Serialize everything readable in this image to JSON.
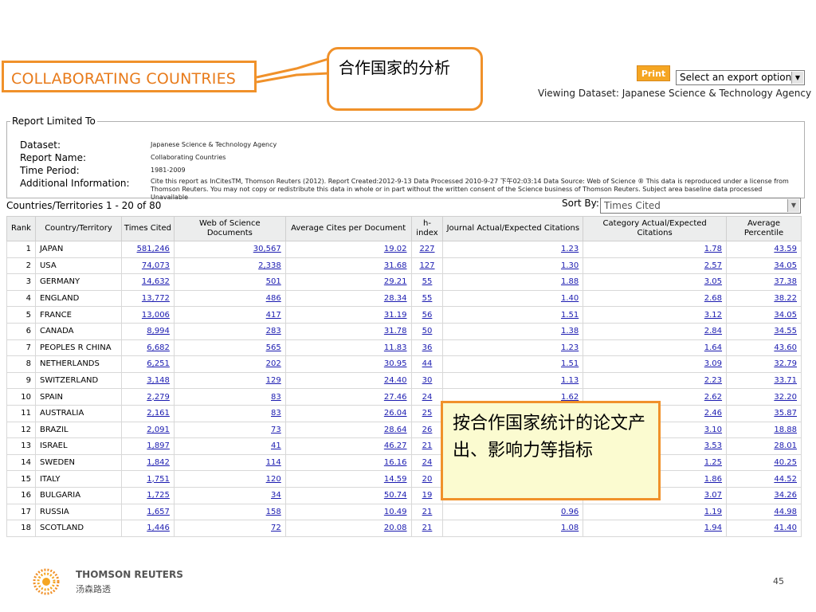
{
  "title": "COLLABORATING COUNTRIES",
  "callout_top": "合作国家的分析",
  "callout_mid": "按合作国家统计的论文产出、影响力等指标",
  "toolbar": {
    "print_label": "Print",
    "export_value": "Select an export option"
  },
  "viewing_dataset": "Viewing Dataset: Japanese Science & Technology Agency",
  "report": {
    "legend": "Report Limited To",
    "labels": [
      "Dataset:",
      "Report Name:",
      "Time Period:",
      "Additional Information:"
    ],
    "values": {
      "dataset": "Japanese Science & Technology Agency",
      "report_name": "Collaborating Countries",
      "time_period": "1981-2009",
      "additional_info": "Cite this report as InCitesTM, Thomson Reuters (2012). Report Created:2012-9-13  Data Processed 2010-9-27 下午02:03:14  Data Source: Web of Science ® This data is reproduced under a license from Thomson Reuters. You may not copy or redistribute this data in whole or in part without the written consent of the Science business of Thomson Reuters. Subject area baseline data processed Unavailable"
    }
  },
  "count_line": "Countries/Territories 1 - 20  of  80",
  "sort": {
    "label": "Sort By:",
    "value": "Times Cited"
  },
  "table": {
    "headers": [
      "Rank",
      "Country/Territory",
      "Times Cited",
      "Web of Science Documents",
      "Average Cites per Document",
      "h-index",
      "Journal Actual/Expected Citations",
      "Category Actual/Expected Citations",
      "Average Percentile"
    ],
    "rows": [
      [
        "1",
        "JAPAN",
        "581,246",
        "30,567",
        "19.02",
        "227",
        "1.23",
        "1.78",
        "43.59"
      ],
      [
        "2",
        "USA",
        "74,073",
        "2,338",
        "31.68",
        "127",
        "1.30",
        "2.57",
        "34.05"
      ],
      [
        "3",
        "GERMANY",
        "14,632",
        "501",
        "29.21",
        "55",
        "1.88",
        "3.05",
        "37.38"
      ],
      [
        "4",
        "ENGLAND",
        "13,772",
        "486",
        "28.34",
        "55",
        "1.40",
        "2.68",
        "38.22"
      ],
      [
        "5",
        "FRANCE",
        "13,006",
        "417",
        "31.19",
        "56",
        "1.51",
        "3.12",
        "34.05"
      ],
      [
        "6",
        "CANADA",
        "8,994",
        "283",
        "31.78",
        "50",
        "1.38",
        "2.84",
        "34.55"
      ],
      [
        "7",
        "PEOPLES R CHINA",
        "6,682",
        "565",
        "11.83",
        "36",
        "1.23",
        "1.64",
        "43.60"
      ],
      [
        "8",
        "NETHERLANDS",
        "6,251",
        "202",
        "30.95",
        "44",
        "1.51",
        "3.09",
        "32.79"
      ],
      [
        "9",
        "SWITZERLAND",
        "3,148",
        "129",
        "24.40",
        "30",
        "1.13",
        "2.23",
        "33.71"
      ],
      [
        "10",
        "SPAIN",
        "2,279",
        "83",
        "27.46",
        "24",
        "1.62",
        "2.62",
        "32.20"
      ],
      [
        "11",
        "AUSTRALIA",
        "2,161",
        "83",
        "26.04",
        "25",
        "",
        "2.46",
        "35.87"
      ],
      [
        "12",
        "BRAZIL",
        "2,091",
        "73",
        "28.64",
        "26",
        "",
        "3.10",
        "18.88"
      ],
      [
        "13",
        "ISRAEL",
        "1,897",
        "41",
        "46.27",
        "21",
        "",
        "3.53",
        "28.01"
      ],
      [
        "14",
        "SWEDEN",
        "1,842",
        "114",
        "16.16",
        "24",
        "",
        "1.25",
        "40.25"
      ],
      [
        "15",
        "ITALY",
        "1,751",
        "120",
        "14.59",
        "20",
        "",
        "1.86",
        "44.52"
      ],
      [
        "16",
        "BULGARIA",
        "1,725",
        "34",
        "50.74",
        "19",
        "",
        "3.07",
        "34.26"
      ],
      [
        "17",
        "RUSSIA",
        "1,657",
        "158",
        "10.49",
        "21",
        "0.96",
        "1.19",
        "44.98"
      ],
      [
        "18",
        "SCOTLAND",
        "1,446",
        "72",
        "20.08",
        "21",
        "1.08",
        "1.94",
        "41.40"
      ]
    ]
  },
  "footer": {
    "company": "THOMSON REUTERS",
    "company_cn": "汤森路透",
    "page_number": "45"
  },
  "colors": {
    "accent_orange": "#f0912a",
    "link_blue": "#1b1bb0",
    "note_bg": "#fbfbd0"
  }
}
